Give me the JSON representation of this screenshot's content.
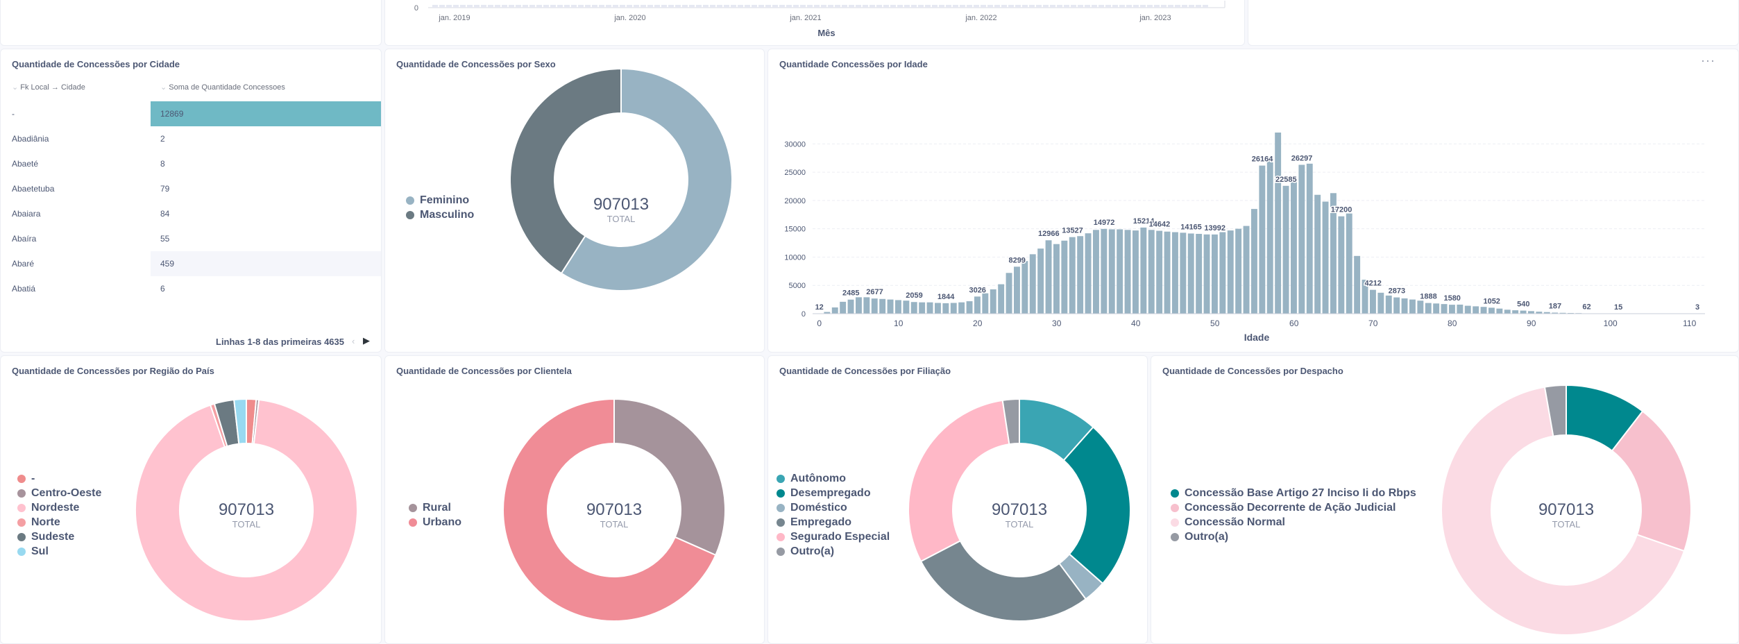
{
  "top_timeline": {
    "x_ticks": [
      "jan. 2019",
      "jan. 2020",
      "jan. 2021",
      "jan. 2022",
      "jan. 2023"
    ],
    "y_tick": "0",
    "xlabel": "Mês"
  },
  "cidade_card": {
    "title": "Quantidade de Concessões por Cidade",
    "col1": "Fk Local → Cidade",
    "col2": "Soma de Quantidade Concessoes",
    "rows": [
      {
        "cidade": "-",
        "valor": "12869"
      },
      {
        "cidade": "Abadiânia",
        "valor": "2"
      },
      {
        "cidade": "Abaeté",
        "valor": "8"
      },
      {
        "cidade": "Abaetetuba",
        "valor": "79"
      },
      {
        "cidade": "Abaiara",
        "valor": "84"
      },
      {
        "cidade": "Abaíra",
        "valor": "55"
      },
      {
        "cidade": "Abaré",
        "valor": "459"
      },
      {
        "cidade": "Abatiá",
        "valor": "6"
      }
    ],
    "pagination": "Linhas 1-8 das primeiras 4635",
    "prev_icon": "chevron-left-icon",
    "next_icon": "chevron-right-icon"
  },
  "more_icon": "ellipsis-icon",
  "chart_data": [
    {
      "type": "pie",
      "title": "Quantidade de Concessões por Sexo",
      "center_value": "907013",
      "center_label": "TOTAL",
      "categories": [
        "Feminino",
        "Masculino"
      ],
      "values": [
        535500,
        371513
      ],
      "colors": [
        "#98b3c3",
        "#6b7a82"
      ]
    },
    {
      "type": "bar",
      "title": "Quantidade Concessões por Idade",
      "xlabel": "Idade",
      "ylabel": "",
      "xlim": [
        0,
        112
      ],
      "ylim": [
        0,
        32000
      ],
      "x_ticks": [
        0,
        10,
        20,
        30,
        40,
        50,
        60,
        70,
        80,
        90,
        100,
        110
      ],
      "y_ticks": [
        0,
        5000,
        10000,
        15000,
        20000,
        25000,
        30000
      ],
      "x": [
        0,
        1,
        2,
        3,
        4,
        5,
        6,
        7,
        8,
        9,
        10,
        11,
        12,
        13,
        14,
        15,
        16,
        17,
        18,
        19,
        20,
        21,
        22,
        23,
        24,
        25,
        26,
        27,
        28,
        29,
        30,
        31,
        32,
        33,
        34,
        35,
        36,
        37,
        38,
        39,
        40,
        41,
        42,
        43,
        44,
        45,
        46,
        47,
        48,
        49,
        50,
        51,
        52,
        53,
        54,
        55,
        56,
        57,
        58,
        59,
        60,
        61,
        62,
        63,
        64,
        65,
        66,
        67,
        68,
        69,
        70,
        71,
        72,
        73,
        74,
        75,
        76,
        77,
        78,
        79,
        80,
        81,
        82,
        83,
        84,
        85,
        86,
        87,
        88,
        89,
        90,
        91,
        92,
        93,
        94,
        95,
        96,
        97,
        98,
        99,
        100,
        101,
        102,
        103,
        104,
        105,
        106,
        107,
        108,
        109,
        110,
        111
      ],
      "values": [
        12,
        300,
        1100,
        2100,
        2485,
        2900,
        2900,
        2677,
        2600,
        2500,
        2400,
        2300,
        2059,
        2000,
        2000,
        1900,
        1844,
        1900,
        2000,
        2200,
        3026,
        3600,
        4300,
        5200,
        7200,
        8299,
        9300,
        10500,
        11500,
        12966,
        12300,
        12900,
        13527,
        13700,
        14200,
        14800,
        14972,
        14900,
        14900,
        14800,
        14700,
        15214,
        14800,
        14642,
        14500,
        14400,
        14300,
        14165,
        14100,
        14000,
        13992,
        14400,
        14700,
        15000,
        15500,
        18500,
        26164,
        27500,
        32000,
        22585,
        24000,
        26297,
        26500,
        21000,
        19800,
        21300,
        17200,
        17700,
        10200,
        6000,
        4212,
        3700,
        3200,
        2873,
        2700,
        2500,
        2300,
        1888,
        1800,
        1700,
        1580,
        1600,
        1400,
        1300,
        1200,
        1052,
        900,
        700,
        600,
        540,
        450,
        350,
        280,
        187,
        150,
        120,
        100,
        62,
        50,
        40,
        30,
        15,
        12,
        10,
        8,
        6,
        5,
        4,
        3,
        3,
        3,
        3
      ],
      "data_labels": [
        {
          "x": 0,
          "label": "12"
        },
        {
          "x": 4,
          "label": "2485"
        },
        {
          "x": 7,
          "label": "2677"
        },
        {
          "x": 12,
          "label": "2059"
        },
        {
          "x": 16,
          "label": "1844"
        },
        {
          "x": 20,
          "label": "3026"
        },
        {
          "x": 25,
          "label": "8299"
        },
        {
          "x": 29,
          "label": "12966"
        },
        {
          "x": 32,
          "label": "13527"
        },
        {
          "x": 36,
          "label": "14972"
        },
        {
          "x": 41,
          "label": "15214"
        },
        {
          "x": 43,
          "label": "14642"
        },
        {
          "x": 47,
          "label": "14165"
        },
        {
          "x": 50,
          "label": "13992"
        },
        {
          "x": 56,
          "label": "26164"
        },
        {
          "x": 59,
          "label": "22585"
        },
        {
          "x": 61,
          "label": "26297"
        },
        {
          "x": 66,
          "label": "17200"
        },
        {
          "x": 70,
          "label": "4212"
        },
        {
          "x": 73,
          "label": "2873"
        },
        {
          "x": 77,
          "label": "1888"
        },
        {
          "x": 80,
          "label": "1580"
        },
        {
          "x": 85,
          "label": "1052"
        },
        {
          "x": 89,
          "label": "540"
        },
        {
          "x": 93,
          "label": "187"
        },
        {
          "x": 97,
          "label": "62"
        },
        {
          "x": 101,
          "label": "15"
        },
        {
          "x": 111,
          "label": "3"
        }
      ],
      "color": "#98b3c3",
      "grid": true
    },
    {
      "type": "pie",
      "title": "Quantidade de Concessões por Região do País",
      "center_value": "907013",
      "center_label": "TOTAL",
      "categories": [
        "-",
        "Centro-Oeste",
        "Nordeste",
        "Norte",
        "Sudeste",
        "Sul"
      ],
      "values": [
        12869,
        3500,
        843000,
        5500,
        26000,
        16144
      ],
      "colors": [
        "#ef8c8c",
        "#a7939c",
        "#ffc2cf",
        "#f49fa3",
        "#6b7a82",
        "#98d9f0"
      ]
    },
    {
      "type": "pie",
      "title": "Quantidade de Concessões por Clientela",
      "center_value": "907013",
      "center_label": "TOTAL",
      "categories": [
        "Rural",
        "Urbano"
      ],
      "values": [
        287000,
        620013
      ],
      "colors": [
        "#a5939b",
        "#f08c96"
      ]
    },
    {
      "type": "pie",
      "title": "Quantidade de Concessões por Filiação",
      "center_value": "907013",
      "center_label": "TOTAL",
      "categories": [
        "Autônomo",
        "Desempregado",
        "Doméstico",
        "Empregado",
        "Segurado Especial",
        "Outro(a)"
      ],
      "values": [
        105000,
        226000,
        30000,
        250000,
        274000,
        22013
      ],
      "colors": [
        "#3aa5b3",
        "#00888e",
        "#98b3c3",
        "#76868f",
        "#ffb8c7",
        "#969aa3"
      ]
    },
    {
      "type": "pie",
      "title": "Quantidade de Concessões por Despacho",
      "center_value": "907013",
      "center_label": "TOTAL",
      "categories": [
        "Concessão Base Artigo 27 Inciso Ii do Rbps",
        "Concessão Decorrente de Ação Judicial",
        "Concessão Normal",
        "Outro(a)"
      ],
      "values": [
        95000,
        180000,
        607013,
        25000
      ],
      "colors": [
        "#00888e",
        "#f7c0cd",
        "#fbdbe4",
        "#969aa3"
      ]
    }
  ]
}
